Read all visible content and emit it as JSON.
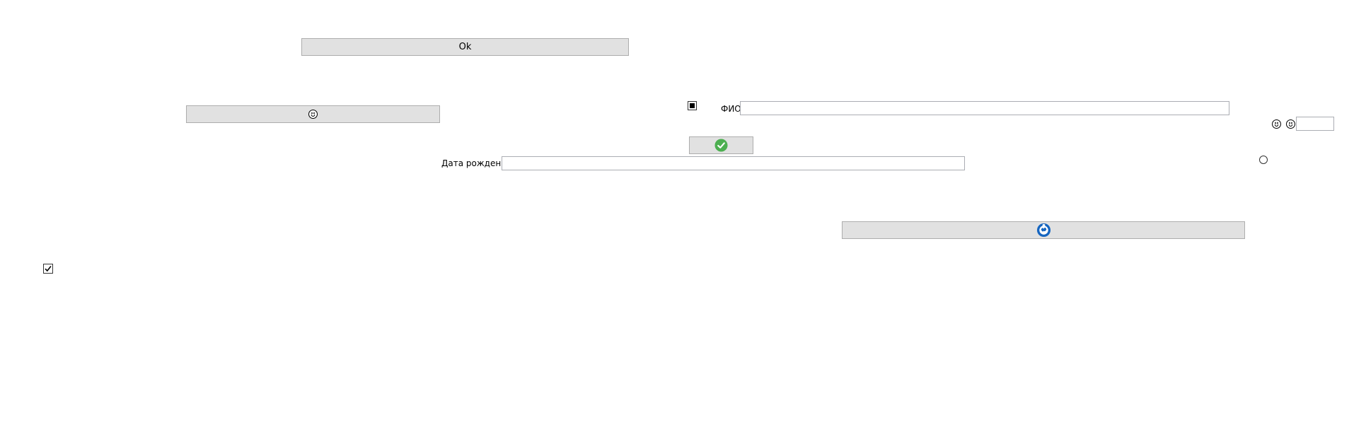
{
  "ok_button": {
    "label": "Ok"
  },
  "fio": {
    "label": "ФИО",
    "value": "",
    "placeholder": ""
  },
  "birth_date": {
    "label": "Дата рождения",
    "value": "",
    "placeholder": ""
  },
  "small_field": {
    "value": "",
    "placeholder": ""
  },
  "checkbox_filled": {
    "state": "indeterminate"
  },
  "checkbox_bottom": {
    "checked": true
  },
  "radio": {
    "checked": false
  },
  "icons": {
    "emoji_button": "laughing-face-icon",
    "check_button": "green-check-icon",
    "globe_button": "blue-globe-icon",
    "emoji_1": "laughing-face-icon",
    "emoji_2": "grinning-face-icon"
  },
  "colors": {
    "button_bg": "#e1e1e1",
    "button_border": "#adadad",
    "check_green": "#4caf50",
    "globe_blue": "#1565c0"
  }
}
